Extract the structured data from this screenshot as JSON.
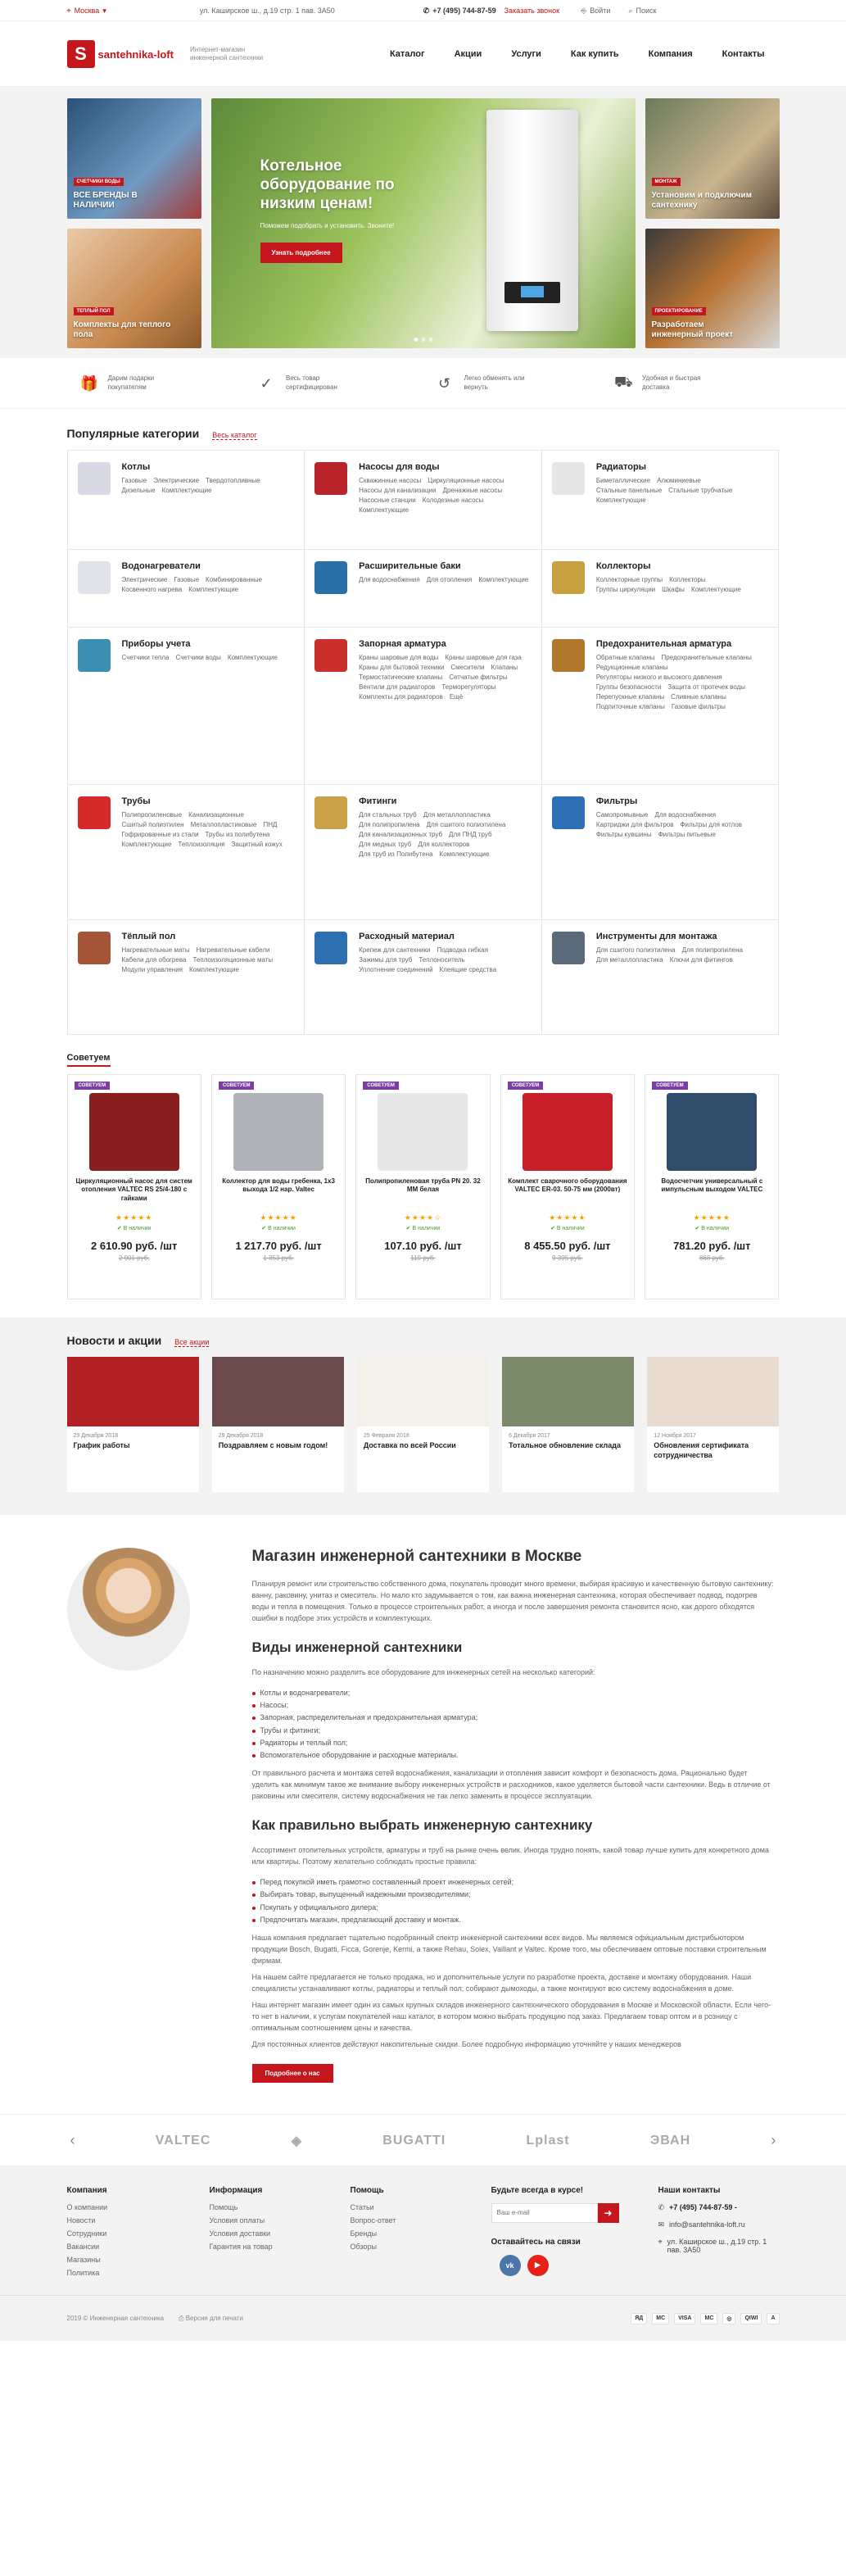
{
  "topbar": {
    "city": "Москва",
    "address": "ул. Каширское ш., д.19 стр. 1 пав. 3А50",
    "phone": "+7 (495) 744-87-59",
    "callback": "Заказать звонок",
    "login": "Войти",
    "search": "Поиск"
  },
  "header": {
    "logo_letter": "S",
    "logo_text": "santehnika-loft",
    "tagline": "Интернет-магазин инженерной сантехники",
    "nav": [
      "Каталог",
      "Акции",
      "Услуги",
      "Как купить",
      "Компания",
      "Контакты"
    ]
  },
  "hero": {
    "left_tiles": [
      {
        "badge": "СЧЕТЧИКИ ВОДЫ",
        "title": "ВСЕ БРЕНДЫ В НАЛИЧИИ"
      },
      {
        "badge": "ТЕПЛЫЙ ПОЛ",
        "title": "Комплекты для теплого пола"
      }
    ],
    "slide": {
      "title": "Котельное оборудование по низким ценам!",
      "subtitle": "Поможем подобрать и установить. Звоните!",
      "button": "Узнать подробнее"
    },
    "right_tiles": [
      {
        "badge": "МОНТАЖ",
        "title": "Установим и подключим сантехнику"
      },
      {
        "badge": "ПРОЕКТИРОВАНИЕ",
        "title": "Разработаем инженерный проект"
      }
    ]
  },
  "features": [
    {
      "icon": "gift-icon",
      "glyph": "🎁",
      "text": "Дарим подарки покупателям"
    },
    {
      "icon": "shield-check-icon",
      "glyph": "✓",
      "text": "Весь товар сертифицирован"
    },
    {
      "icon": "return-icon",
      "glyph": "↺",
      "text": "Легко обменять или вернуть"
    },
    {
      "icon": "truck-icon",
      "glyph": "⛟",
      "text": "Удобная и быстрая доставка"
    }
  ],
  "categories": {
    "title": "Популярные категории",
    "all_link": "Весь каталог",
    "items": [
      {
        "name": "Котлы",
        "color": "#d9d9e6",
        "links": [
          "Газовые",
          "Электрические",
          "Твердотопливные",
          "Дизельные",
          "Комплектующие"
        ]
      },
      {
        "name": "Насосы для воды",
        "color": "#b8242a",
        "links": [
          "Скважинные насосы",
          "Циркуляционные насосы",
          "Насосы для канализации",
          "Дренажные насосы",
          "Насосные станции",
          "Колодезные насосы",
          "Комплектующие"
        ]
      },
      {
        "name": "Радиаторы",
        "color": "#e6e6e6",
        "links": [
          "Биметаллические",
          "Алюминиевые",
          "Стальные панельные",
          "Стальные трубчатые",
          "Комплектующие"
        ]
      },
      {
        "name": "Водонагреватели",
        "color": "#e0e3e8",
        "links": [
          "Электрические",
          "Газовые",
          "Комбинированные",
          "Косвенного нагрева",
          "Комплектующие"
        ]
      },
      {
        "name": "Расширительные баки",
        "color": "#2a6fa8",
        "links": [
          "Для водоснабжения",
          "Для отопления",
          "Комплектующие"
        ]
      },
      {
        "name": "Коллекторы",
        "color": "#c7a13f",
        "links": [
          "Коллекторные группы",
          "Коллекторы",
          "Группы циркуляции",
          "Шкафы",
          "Комплектующие"
        ]
      },
      {
        "name": "Приборы учета",
        "color": "#3c8fb0",
        "links": [
          "Счетчики тепла",
          "Счетчики воды",
          "Комплектующие"
        ]
      },
      {
        "name": "Запорная арматура",
        "color": "#c9302c",
        "links": [
          "Краны шаровые для воды",
          "Краны шаровые для газа",
          "Краны для бытовой техники",
          "Смесители",
          "Клапаны",
          "Термостатические клапаны",
          "Сетчатые фильтры",
          "Вентили для радиаторов",
          "Терморегуляторы",
          "Комплекты для радиаторов",
          "Ещё"
        ]
      },
      {
        "name": "Предохранительная арматура",
        "color": "#b0782c",
        "links": [
          "Обратные клапаны",
          "Предохранительные клапаны",
          "Редукционные клапаны",
          "Регуляторы низкого и высокого давления",
          "Группы безопасности",
          "Защита от протечек воды",
          "Перепускные клапаны",
          "Сливные клапаны",
          "Подпиточные клапаны",
          "Газовые фильтры"
        ]
      },
      {
        "name": "Трубы",
        "color": "#d42a2a",
        "links": [
          "Полипропиленовые",
          "Канализационные",
          "Сшитый полиэтилен",
          "Металлопластиковые",
          "ПНД",
          "Гофрированные из стали",
          "Трубы из полибутена",
          "Комплектующие",
          "Теплоизоляция",
          "Защитный кожух"
        ]
      },
      {
        "name": "Фитинги",
        "color": "#c9a24a",
        "links": [
          "Для стальных труб",
          "Для металлопластика",
          "Для полипропилена",
          "Для сшитого полиэтилена",
          "Для канализационных труб",
          "Для ПНД труб",
          "Для медных труб",
          "Для коллекторов",
          "Для труб из Полибутена",
          "Комплектующие"
        ]
      },
      {
        "name": "Фильтры",
        "color": "#2f6fb5",
        "links": [
          "Самопромывные",
          "Для водоснабжения",
          "Картриджи для фильтров",
          "Фильтры для котлов",
          "Фильтры кувшины",
          "Фильтры питьевые"
        ]
      },
      {
        "name": "Тёплый пол",
        "color": "#a5563a",
        "links": [
          "Нагревательные маты",
          "Нагревательные кабели",
          "Кабели для обогрева",
          "Теплоизоляционные маты",
          "Модули управления",
          "Комплектующие"
        ]
      },
      {
        "name": "Расходный материал",
        "color": "#2d6fb0",
        "links": [
          "Крепеж для сантехники",
          "Подводка гибкая",
          "Зажимы для труб",
          "Теплоноситель",
          "Уплотнение соединений",
          "Клеящие средства"
        ]
      },
      {
        "name": "Инструменты для монтажа",
        "color": "#5a6a7a",
        "links": [
          "Для сшитого полиэтилена",
          "Для полипропилена",
          "Для металлопластика",
          "Ключи для фитингов"
        ]
      }
    ]
  },
  "recommended": {
    "title": "Советуем",
    "badge": "СОВЕТУЕМ",
    "stock": "✔ В наличии",
    "products": [
      {
        "name": "Циркуляционный насос для систем отопления VALTEC RS 25/4-180 с гайками",
        "price": "2 610.90 руб. /шт",
        "old": "2 901 руб.",
        "color": "#8a1f1f",
        "stars": "★★★★★"
      },
      {
        "name": "Коллектор для воды гребенка, 1x3 выхода 1/2 нар. Valtec",
        "price": "1 217.70 руб. /шт",
        "old": "1 353 руб.",
        "color": "#b0b4ba",
        "stars": "★★★★★"
      },
      {
        "name": "Полипропиленовая труба PN 20. 32 ММ белая",
        "price": "107.10 руб. /шт",
        "old": "119 руб.",
        "color": "#e8e8e8",
        "stars": "★★★★☆"
      },
      {
        "name": "Комплект сварочного оборудования VALTEC ER-03. 50-75 мм (2000вт)",
        "price": "8 455.50 руб. /шт",
        "old": "9 395 руб.",
        "color": "#c8202a",
        "stars": "★★★★★"
      },
      {
        "name": "Водосчетчик универсальный с импульсным выходом VALTEC",
        "price": "781.20 руб. /шт",
        "old": "868 руб.",
        "color": "#2f4c6a",
        "stars": "★★★★★"
      }
    ]
  },
  "news": {
    "title": "Новости и акции",
    "all_link": "Все акции",
    "items": [
      {
        "date": "29 Декабря 2018",
        "title": "График работы",
        "color": "#b21f24"
      },
      {
        "date": "29 Декабря 2018",
        "title": "Поздравляем с новым годом!",
        "color": "#6a4a4a"
      },
      {
        "date": "25 Февраля 2018",
        "title": "Доставка по всей России",
        "color": "#f4f0ea"
      },
      {
        "date": "6 Декабря 2017",
        "title": "Тотальное обновление склада",
        "color": "#7a8a6a"
      },
      {
        "date": "12 Ноября 2017",
        "title": "Обновления сертификата сотрудничества",
        "color": "#e8dcd0"
      }
    ]
  },
  "about": {
    "h1": "Магазин инженерной сантехники в Москве",
    "p1": "Планируя ремонт или строительство собственного дома, покупатель проводит много времени, выбирая красивую и качественную бытовую сантехнику: ванну, раковину, унитаз и смеситель. Но мало кто задумывается о том, как важна инженерная сантехника, которая обеспечивает подвод, подогрев воды и тепла в помещения. Только в процессе строительных работ, а иногда и после завершения ремонта становится ясно, как дорого обходятся ошибки в подборе этих устройств и комплектующих.",
    "h2": "Виды инженерной сантехники",
    "p2": "По назначению можно разделить все оборудование для инженерных сетей на несколько категорий:",
    "list1": [
      "Котлы и водонагреватели;",
      "Насосы;",
      "Запорная, распределительная и предохранительная арматура;",
      "Трубы и фитинги;",
      "Радиаторы и теплый пол;",
      "Вспомогательное оборудование и расходные материалы."
    ],
    "p3": "От правильного расчета и монтажа сетей водоснабжения, канализации и отопления зависит комфорт и безопасность дома. Рационально будет уделить как минимум такое же внимание выбору инженерных устройств и расходников, какое уделяется бытовой части сантехники. Ведь в отличие от раковины или смесителя, систему водоснабжения не так легко заменить в процессе эксплуатации.",
    "h3": "Как правильно выбрать инженерную сантехнику",
    "p4": "Ассортимент отопительных устройств, арматуры и труб на рынке очень велик. Иногда трудно понять, какой товар лучше купить для конкретного дома или квартиры. Поэтому желательно соблюдать простые правила:",
    "list2": [
      "Перед покупкой иметь грамотно составленный проект инженерных сетей;",
      "Выбирать товар, выпущенный надежными производителями;",
      "Покупать у официального дилера;",
      "Предпочитать магазин, предлагающий доставку и монтаж."
    ],
    "p5": "Наша компания предлагает тщательно подобранный спектр инженерной сантехники всех видов. Мы являемся официальным дистрибьютором продукции Bosch, Bugatti, Ficca, Gorenje, Kermi, а также Rehau, Solex, Vaillant и Valtec. Кроме того, мы обеспечиваем оптовые поставки строительным фирмам.",
    "p6": "На нашем сайте предлагается не только продажа, но и дополнительные услуги по разработке проекта, доставке и монтажу оборудования. Наши специалисты устанавливают котлы, радиаторы и теплый пол; собирают дымоходы, а также монтируют всю систему водоснабжения в доме.",
    "p7": "Наш интернет магазин имеет один из самых крупных складов инженерного сантехнического оборудования в Москве и Московской области. Если чего-то нет в наличии, к услугам покупателей наш каталог, в котором можно выбрать продукцию под заказ. Предлагаем товар оптом и в розницу с оптимальным соотношением цены и качества.",
    "p8": "Для постоянных клиентов действуют накопительные скидки. Более подробную информацию уточняйте у наших менеджеров",
    "button": "Подробнее о нас"
  },
  "brands": [
    "VALTEC",
    "◈",
    "BUGATTI",
    "Lplast",
    "ЭВАН"
  ],
  "footer": {
    "company": {
      "title": "Компания",
      "links": [
        "О компании",
        "Новости",
        "Сотрудники",
        "Вакансии",
        "Магазины",
        "Политика"
      ]
    },
    "info": {
      "title": "Информация",
      "links": [
        "Помощь",
        "Условия оплаты",
        "Условия доставки",
        "Гарантия на товар"
      ]
    },
    "help": {
      "title": "Помощь",
      "links": [
        "Статьи",
        "Вопрос-ответ",
        "Бренды",
        "Обзоры"
      ]
    },
    "subscribe": {
      "title": "Будьте всегда в курсе!",
      "placeholder": "Ваш e-mail",
      "social_title": "Оставайтесь на связи"
    },
    "contacts": {
      "title": "Наши контакты",
      "phone": "+7 (495) 744-87-59 -",
      "email": "info@santehnika-loft.ru",
      "address": "ул. Каширское ш., д.19 стр. 1 пав. 3А50"
    },
    "copyright": "2019 © Инженерная сантехника",
    "version": "Версия для печати",
    "pays": [
      "ЯД",
      "MC",
      "VISA",
      "MC",
      "◎",
      "QIWI",
      "А"
    ]
  }
}
